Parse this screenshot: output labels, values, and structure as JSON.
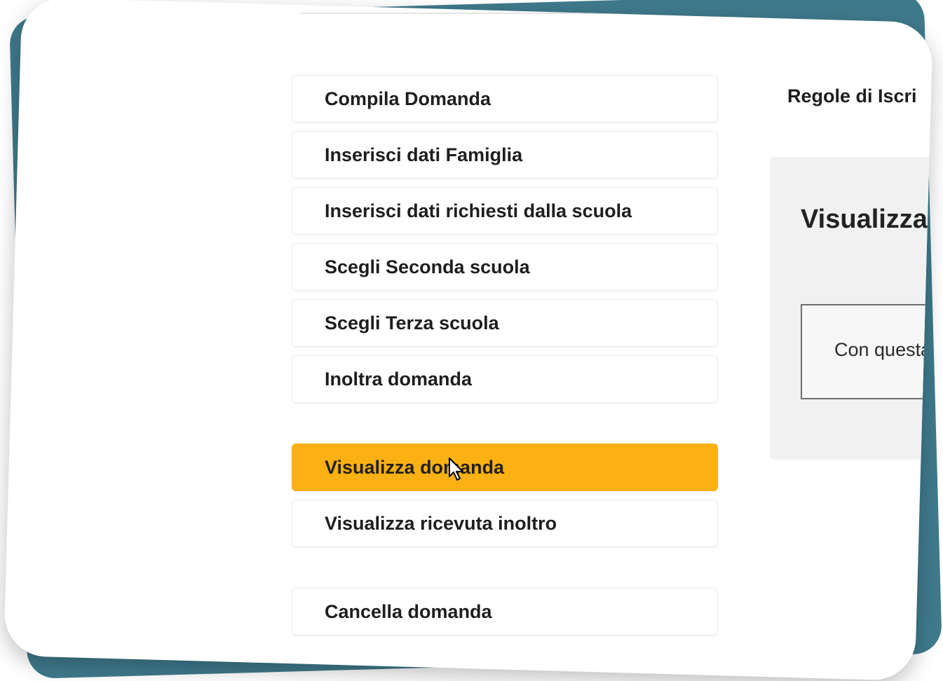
{
  "menu": {
    "items": [
      {
        "label": "Compila Domanda"
      },
      {
        "label": "Inserisci dati Famiglia"
      },
      {
        "label": "Inserisci dati richiesti dalla scuola"
      },
      {
        "label": "Scegli Seconda scuola"
      },
      {
        "label": "Scegli Terza scuola"
      },
      {
        "label": "Inoltra domanda"
      },
      {
        "label": "Visualizza domanda",
        "active": true
      },
      {
        "label": "Visualizza ricevuta inoltro"
      },
      {
        "label": "Cancella domanda"
      }
    ]
  },
  "header": {
    "regole_label": "Regole di Iscri"
  },
  "panel": {
    "title": "Visualizza",
    "box_text": "Con questa"
  },
  "colors": {
    "accent": "#fbb113",
    "frame": "#3f7a8c"
  }
}
